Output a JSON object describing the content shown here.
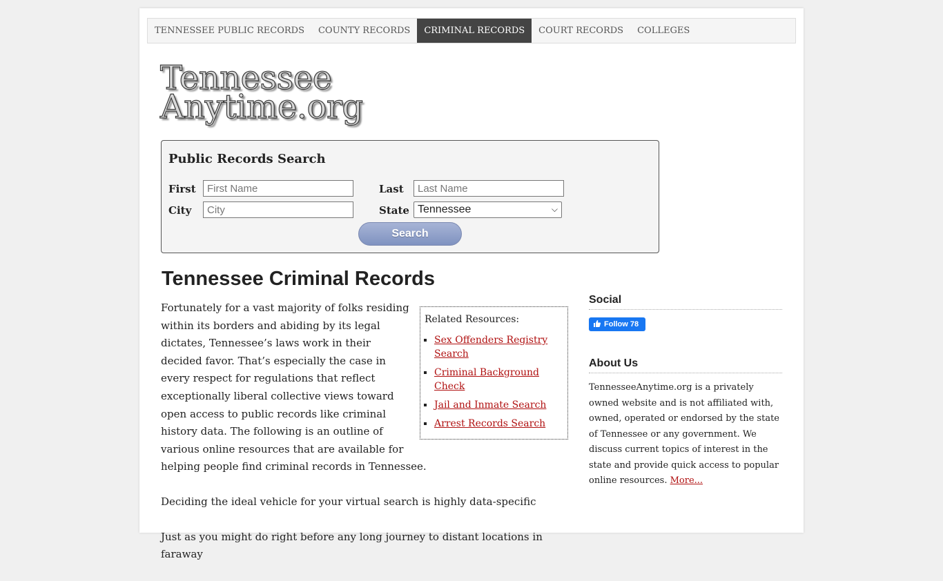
{
  "nav": {
    "items": [
      {
        "label": "TENNESSEE PUBLIC RECORDS"
      },
      {
        "label": "COUNTY RECORDS"
      },
      {
        "label": "CRIMINAL RECORDS"
      },
      {
        "label": "COURT RECORDS"
      },
      {
        "label": "COLLEGES"
      }
    ],
    "active_index": 2
  },
  "logo": {
    "line1": "Tennessee",
    "line2": "Anytime.org"
  },
  "search": {
    "title": "Public Records Search",
    "first_label": "First",
    "first_placeholder": "First Name",
    "last_label": "Last",
    "last_placeholder": "Last Name",
    "city_label": "City",
    "city_placeholder": "City",
    "state_label": "State",
    "state_value": "Tennessee",
    "button_label": "Search"
  },
  "article": {
    "title": "Tennessee Criminal Records",
    "paragraphs": [
      "Fortunately for a vast majority of folks residing within its borders and abiding by its legal dictates, Tennessee’s laws work in their decided favor. That’s especially the case in every respect for regulations that reflect exceptionally liberal collective views toward open access to public records like criminal history data. The following is an outline of various online resources that are available for helping people find criminal records in Tennessee.",
      "Deciding the ideal vehicle for your virtual search is highly data-specific",
      "Just as you might do right before any long journey to distant locations in faraway"
    ]
  },
  "related": {
    "title": "Related Resources:",
    "links": [
      "Sex Offenders Registry Search",
      "Criminal Background Check",
      "Jail and Inmate Search",
      "Arrest Records Search"
    ]
  },
  "sidebar": {
    "social_heading": "Social",
    "follow_label": "Follow 78",
    "about_heading": "About Us",
    "about_text": "TennesseeAnytime.org is a privately owned website and is not affiliated with, owned, operated or endorsed by the state of Tennessee or any government. We discuss current topics of interest in the state and provide quick access to popular online resources.",
    "more_link": "More..."
  },
  "colors": {
    "nav_active_bg": "#444444",
    "link": "#b01010",
    "facebook": "#1877f2",
    "search_button": "#8a9ac6"
  }
}
